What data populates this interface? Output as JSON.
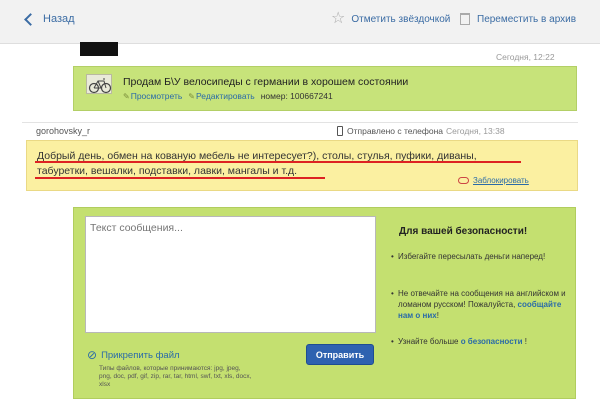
{
  "topbar": {
    "back_label": "Назад",
    "star_label": "Отметить звёздочкой",
    "archive_label": "Переместить в архив"
  },
  "ad": {
    "timestamp": "Сегодня, 12:22",
    "title": "Продам Б\\У велосипеды с германии в хорошем состоянии",
    "view_label": "Просмотреть",
    "edit_label": "Редактировать",
    "number_label": "номер: 100667241"
  },
  "message": {
    "sender": "gorohovsky_r",
    "via_label": "Отправлено с телефона",
    "timestamp": "Сегодня, 13:38",
    "line1": "Добрый день, обмен на кованую мебель не интересует?), столы, стулья, пуфики, диваны,",
    "line2": "табуретки, вешалки, подставки, лавки, мангалы и т.д.",
    "complain_label": "Заблокировать"
  },
  "reply": {
    "placeholder": "Текст сообщения...",
    "attach_label": "Прикрепить файл",
    "file_types": "Типы файлов, которые принимаются: jpg, jpeg, png, doc, pdf, gif, zip, rar, tar, html, swf, txt, xls, docx, xlsx",
    "send_label": "Отправить"
  },
  "security": {
    "title": "Для вашей безопасности!",
    "tip1": "Избегайте пересылать деньги наперед!",
    "tip2_text": "Не отвечайте на сообщения на английском и ломаном русском! Пожалуйста,",
    "tip2_link": "сообщайте нам о них",
    "tip2_end": "!",
    "tip3_text": "Узнайте больше",
    "tip3_link": "о безопасности",
    "tip3_end": "!"
  },
  "annotation_color": "#dd2222"
}
